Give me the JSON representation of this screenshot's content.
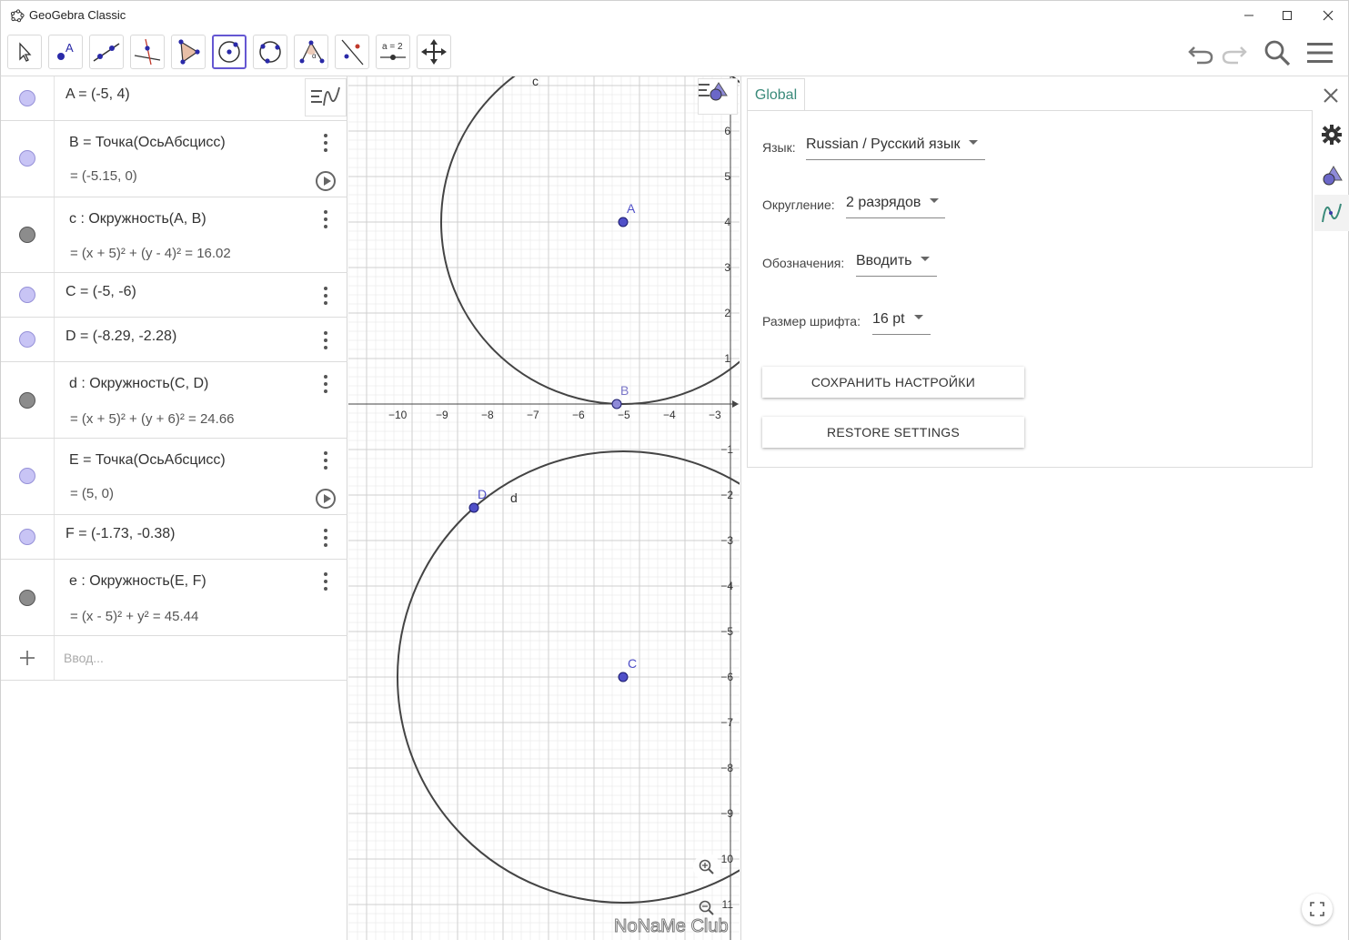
{
  "window": {
    "title": "GeoGebra Classic"
  },
  "toolbar": {
    "tools": [
      {
        "name": "move-tool",
        "icon": "arrow-cursor-icon"
      },
      {
        "name": "point-tool",
        "icon": "point-icon"
      },
      {
        "name": "line-tool",
        "icon": "line-icon"
      },
      {
        "name": "perpendicular-line-tool",
        "icon": "perpendicular-icon"
      },
      {
        "name": "polygon-tool",
        "icon": "polygon-icon"
      },
      {
        "name": "circle-center-point-tool",
        "icon": "circle-center-icon"
      },
      {
        "name": "circle-three-points-tool",
        "icon": "circle-three-points-icon"
      },
      {
        "name": "angle-tool",
        "icon": "angle-icon"
      },
      {
        "name": "reflect-tool",
        "icon": "reflect-icon"
      },
      {
        "name": "slider-tool",
        "icon": "slider-icon"
      },
      {
        "name": "move-graphics-tool",
        "icon": "move-view-icon"
      }
    ],
    "slider_label": "a = 2",
    "active_tool": "circle-center-point-tool"
  },
  "algebra": {
    "rows": [
      {
        "marble": "point",
        "text": "A = (-5, 4)"
      },
      {
        "marble": "point",
        "text": "B = Точка(ОсьАбсцисс)",
        "value": "= (-5.15, 0)",
        "play": true
      },
      {
        "marble": "circle",
        "text": "c : Окружность(A, B)",
        "value": "= (x + 5)² + (y - 4)² = 16.02"
      },
      {
        "marble": "point",
        "text": "C = (-5, -6)"
      },
      {
        "marble": "point",
        "text": "D = (-8.29, -2.28)"
      },
      {
        "marble": "circle",
        "text": "d : Окружность(C, D)",
        "value": "= (x + 5)² + (y + 6)² = 24.66"
      },
      {
        "marble": "point",
        "text": "E = Точка(ОсьАбсцисс)",
        "value": "= (5, 0)",
        "play": true
      },
      {
        "marble": "point",
        "text": "F = (-1.73, -0.38)"
      },
      {
        "marble": "circle",
        "text": "e : Окружность(E, F)",
        "value": "= (x - 5)² + y² = 45.44"
      }
    ],
    "input_placeholder": "Ввод..."
  },
  "graphics": {
    "x_ticks": [
      "−10",
      "−9",
      "−8",
      "−7",
      "−6",
      "−5",
      "−4",
      "−3"
    ],
    "y_ticks_pos": [
      "6",
      "5",
      "4",
      "3",
      "2",
      "1"
    ],
    "y_ticks_neg": [
      "−1",
      "−2",
      "−3",
      "−4",
      "−5",
      "−6",
      "−7",
      "−8",
      "−9",
      "10",
      "11"
    ],
    "labels": {
      "A": "A",
      "B": "B",
      "C": "C",
      "D": "D",
      "c": "c",
      "d": "d"
    },
    "watermark": "NoNaMe Club",
    "colors": {
      "point": "#5050c8",
      "curve": "#333333",
      "grid": "#e6e6e6",
      "axis": "#444444"
    }
  },
  "settings": {
    "tab": "Global",
    "language_label": "Язык:",
    "language_value": "Russian / Русский язык",
    "rounding_label": "Округление:",
    "rounding_value": "2 разрядов",
    "labeling_label": "Обозначения:",
    "labeling_value": "Вводить",
    "font_label": "Размер шрифта:",
    "font_value": "16 pt",
    "save_button": "СОХРАНИТЬ НАСТРОЙКИ",
    "restore_button": "RESTORE SETTINGS",
    "accent": "#3a8a7a"
  }
}
